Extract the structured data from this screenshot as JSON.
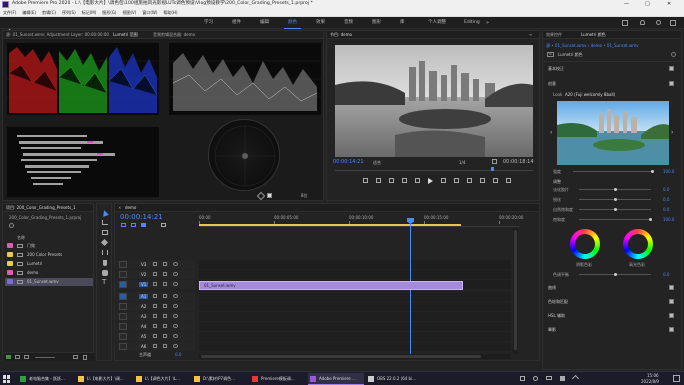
{
  "titlebar": {
    "title": "Adobe Premiere Pro 2020 - L:\\【电影大片】\\调色包\\100组旅拍风光影视LUTs调色预设\\Vlog预设教学\\200_Color_Grading_Presets_1.prproj *",
    "win_controls": [
      "—",
      "□",
      "✕"
    ]
  },
  "menubar": {
    "items": [
      "文件(F)",
      "编辑(E)",
      "剪辑(C)",
      "序列(S)",
      "标记(M)",
      "图形(G)",
      "视图(V)",
      "窗口(W)",
      "帮助(H)"
    ]
  },
  "workspaces": {
    "items": [
      "学习",
      "组件",
      "编辑",
      "颜色",
      "效果",
      "音频",
      "图形",
      "库",
      "个人调整",
      "Editing"
    ],
    "active": "颜色"
  },
  "scopes_panel": {
    "title": "源: 01_Sunset.wmv: Adjustment Layer: 00:00:00:00",
    "lumetri_tab": "Lumetri 范围",
    "tab2": "音频剪辑混合器: demo",
    "scale_label": "8位"
  },
  "program_monitor": {
    "title": "节目: demo",
    "timecode_left": "00:00:14:21",
    "fit": "适合",
    "fraction": "1/4",
    "timecode_right": "00:00:18:14"
  },
  "project_panel": {
    "title": "项目: 200_Color_Grading_Presets_1",
    "path": "200_Color_Grading_Presets_1.prproj",
    "col_name": "名称",
    "items": [
      {
        "label": "门效",
        "color": "#d85fb3"
      },
      {
        "label": "200 Color Presets",
        "color": "#e9c85a"
      },
      {
        "label": "Lumetri",
        "color": "#e9c85a"
      },
      {
        "label": "demo",
        "color": "#d85fb3"
      },
      {
        "label": "01_Sunset.wmv",
        "color": "#7b6bd6"
      }
    ]
  },
  "timeline": {
    "title": "demo",
    "timecode": "00:00:14:21",
    "ruler": [
      "00:00",
      "00:00:05:00",
      "00:00:10:00",
      "00:00:15:00",
      "00:00:20:00"
    ],
    "video_tracks": [
      "V3",
      "V2",
      "V1"
    ],
    "audio_tracks": [
      "A1",
      "A2",
      "A3",
      "A4",
      "A5",
      "A6"
    ],
    "master_label": "主声道",
    "master_value": "0.0",
    "clip_label": "01_Sunset.wmv",
    "clip_color": "#a48ad8"
  },
  "lumetri": {
    "tab_title": "效果控件",
    "tab_active": "Lumetri 颜色",
    "source_line": "源 • 01_Sunset.wmv  ›  demo • 01_Sunset.wmv",
    "effect_label": "Lumetri 颜色",
    "sections": {
      "basic": "基本校正",
      "creative": "创意",
      "curves": "曲线",
      "color_wheels": "色轮和匹配",
      "hsl": "HSL 辅助",
      "vignette": "晕影"
    },
    "look_label": "Look",
    "look_value": "A20 (Fuji welcomly 8ball)",
    "strength_label": "强度",
    "strength_value": "100.0",
    "adjust_label": "调整",
    "sliders": [
      {
        "label": "淡化胶片",
        "value": "0.0"
      },
      {
        "label": "锐化",
        "value": "0.0"
      },
      {
        "label": "自然饱和度",
        "value": "0.0"
      },
      {
        "label": "饱和度",
        "value": "100.0"
      }
    ],
    "wheel_left_label": "阴影色彩",
    "wheel_right_label": "高光色彩",
    "balance_label": "色调平衡",
    "balance_value": "0.0"
  },
  "taskbar": {
    "items": [
      {
        "label": "老电脑合集 - 跃跃...",
        "color": "#2ea043"
      },
      {
        "label": "L\\【电影大片】\\调...",
        "color": "#f0c14b"
      },
      {
        "label": "L\\【调色大片】\\L...",
        "color": "#f0c14b"
      },
      {
        "label": "D:\\素材\\P7调色...",
        "color": "#f0c14b"
      },
      {
        "label": "Premiere模板调...",
        "color": "#e03a3a"
      },
      {
        "label": "Adobe Premiere ...",
        "color": "#9b59d6"
      },
      {
        "label": "OBS 22.0.2 (64 bi...",
        "color": "#cccccc"
      }
    ],
    "time": "15:06",
    "date": "2022/8/9"
  }
}
